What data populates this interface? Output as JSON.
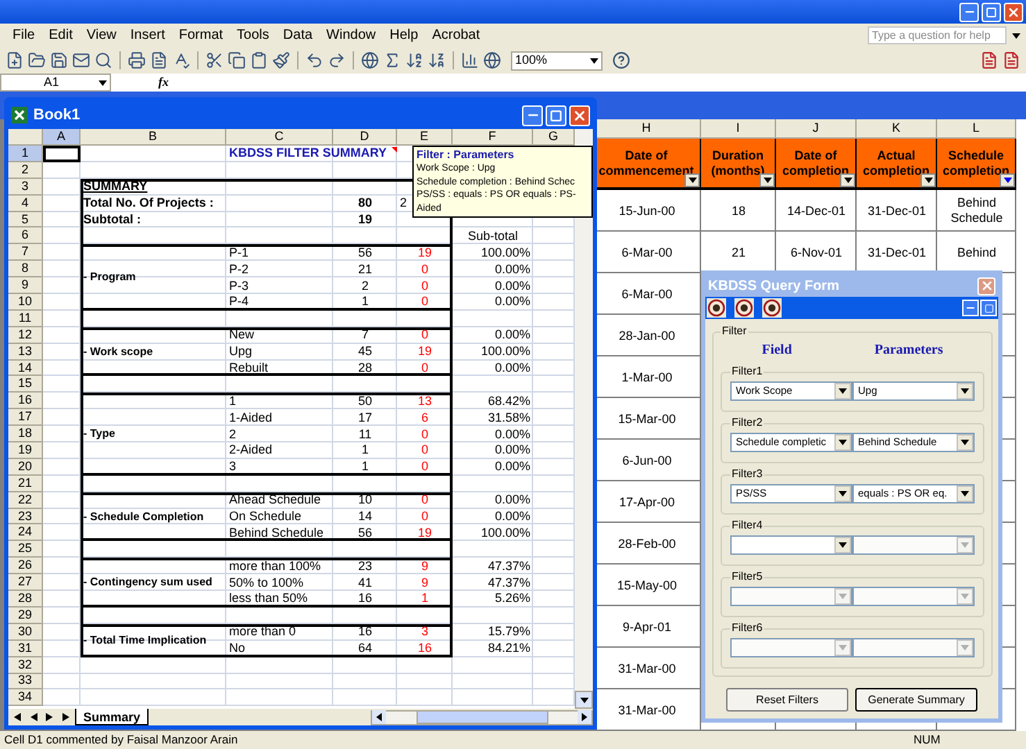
{
  "menu": [
    "File",
    "Edit",
    "View",
    "Insert",
    "Format",
    "Tools",
    "Data",
    "Window",
    "Help",
    "Acrobat"
  ],
  "help_field": {
    "placeholder": "Type a question for help"
  },
  "toolbar": {
    "zoom": "100%"
  },
  "formula_bar": {
    "name_box": "A1",
    "fx": "fx"
  },
  "back_sheet": {
    "columns": [
      "H",
      "I",
      "J",
      "K",
      "L"
    ],
    "headers": [
      {
        "label": "Date of commencement",
        "filtered": false
      },
      {
        "label": "Duration (months)",
        "filtered": false
      },
      {
        "label": "Date of completion",
        "filtered": false
      },
      {
        "label": "Actual completion",
        "filtered": false
      },
      {
        "label": "Schedule completion",
        "filtered": true
      }
    ],
    "rows": [
      [
        "15-Jun-00",
        "18",
        "14-Dec-01",
        "31-Dec-01",
        "Behind Schedule"
      ],
      [
        "6-Mar-00",
        "21",
        "6-Nov-01",
        "31-Dec-01",
        "Behind"
      ],
      [
        "6-Mar-00"
      ],
      [
        "28-Jan-00"
      ],
      [
        "1-Mar-00"
      ],
      [
        "15-Mar-00"
      ],
      [
        "6-Jun-00"
      ],
      [
        "17-Apr-00"
      ],
      [
        "28-Feb-00"
      ],
      [
        "15-May-00"
      ],
      [
        "9-Apr-01"
      ],
      [
        "31-Mar-00"
      ],
      [
        "31-Mar-00"
      ]
    ]
  },
  "book": {
    "title": "Book1",
    "columns": [
      {
        "label": "A",
        "selected": true
      },
      {
        "label": "B",
        "selected": false
      },
      {
        "label": "C",
        "selected": false
      },
      {
        "label": "D",
        "selected": false
      },
      {
        "label": "E",
        "selected": false
      },
      {
        "label": "F",
        "selected": false
      },
      {
        "label": "G",
        "selected": false
      }
    ],
    "rows": [
      {
        "label": "1",
        "selected": true
      },
      {
        "label": "2",
        "selected": false
      },
      {
        "label": "3",
        "selected": false
      },
      {
        "label": "4",
        "selected": false
      },
      {
        "label": "5",
        "selected": false
      },
      {
        "label": "6",
        "selected": false
      },
      {
        "label": "7",
        "selected": false
      },
      {
        "label": "8",
        "selected": false
      },
      {
        "label": "9",
        "selected": false
      },
      {
        "label": "10",
        "selected": false
      },
      {
        "label": "11",
        "selected": false
      },
      {
        "label": "12",
        "selected": false
      },
      {
        "label": "13",
        "selected": false
      },
      {
        "label": "14",
        "selected": false
      },
      {
        "label": "15",
        "selected": false
      },
      {
        "label": "16",
        "selected": false
      },
      {
        "label": "17",
        "selected": false
      },
      {
        "label": "18",
        "selected": false
      },
      {
        "label": "19",
        "selected": false
      },
      {
        "label": "20",
        "selected": false
      },
      {
        "label": "21",
        "selected": false
      },
      {
        "label": "22",
        "selected": false
      },
      {
        "label": "23",
        "selected": false
      },
      {
        "label": "24",
        "selected": false
      },
      {
        "label": "25",
        "selected": false
      },
      {
        "label": "26",
        "selected": false
      },
      {
        "label": "27",
        "selected": false
      },
      {
        "label": "28",
        "selected": false
      },
      {
        "label": "29",
        "selected": false
      },
      {
        "label": "30",
        "selected": false
      },
      {
        "label": "31",
        "selected": false
      },
      {
        "label": "32",
        "selected": false
      },
      {
        "label": "33",
        "selected": false
      },
      {
        "label": "34",
        "selected": false
      }
    ],
    "report": {
      "title": "KBDSS FILTER SUMMARY",
      "heading": "SUMMARY",
      "total_label": "Total No. Of Projects :",
      "total_value": "80",
      "total_extra": "2",
      "subtotal_label": "Subtotal :",
      "subtotal_value": "19",
      "share_heading": "Sub-total",
      "groups": [
        {
          "label": "- Program",
          "items": [
            [
              "P-1",
              "56",
              "19",
              "100.00%"
            ],
            [
              "P-2",
              "21",
              "0",
              "0.00%"
            ],
            [
              "P-3",
              "2",
              "0",
              "0.00%"
            ],
            [
              "P-4",
              "1",
              "0",
              "0.00%"
            ]
          ]
        },
        {
          "label": "- Work scope",
          "items": [
            [
              "New",
              "7",
              "0",
              "0.00%"
            ],
            [
              "Upg",
              "45",
              "19",
              "100.00%"
            ],
            [
              "Rebuilt",
              "28",
              "0",
              "0.00%"
            ]
          ]
        },
        {
          "label": "- Type",
          "items": [
            [
              "1",
              "50",
              "13",
              "68.42%"
            ],
            [
              "1-Aided",
              "17",
              "6",
              "31.58%"
            ],
            [
              "2",
              "11",
              "0",
              "0.00%"
            ],
            [
              "2-Aided",
              "1",
              "0",
              "0.00%"
            ],
            [
              "3",
              "1",
              "0",
              "0.00%"
            ]
          ]
        },
        {
          "label": "- Schedule Completion",
          "items": [
            [
              "Ahead Schedule",
              "10",
              "0",
              "0.00%"
            ],
            [
              "On Schedule",
              "14",
              "0",
              "0.00%"
            ],
            [
              "Behind Schedule",
              "56",
              "19",
              "100.00%"
            ]
          ]
        },
        {
          "label": "- Contingency sum used",
          "items": [
            [
              "more than 100%",
              "23",
              "9",
              "47.37%"
            ],
            [
              "50% to 100%",
              "41",
              "9",
              "47.37%"
            ],
            [
              "less than 50%",
              "16",
              "1",
              "5.26%"
            ]
          ]
        },
        {
          "label": "- Total Time Implication",
          "items": [
            [
              "more than 0",
              "16",
              "3",
              "15.79%"
            ],
            [
              "No",
              "64",
              "16",
              "84.21%"
            ]
          ]
        }
      ]
    },
    "comment": {
      "title": "Filter : Parameters",
      "lines": [
        "Work Scope : Upg",
        "Schedule completion : Behind Schec",
        "PS/SS : equals : PS OR equals : PS-",
        "Aided"
      ]
    },
    "sheet_tabs": [
      {
        "label": "Summary",
        "selected": true
      }
    ]
  },
  "query_form": {
    "title": "KBDSS Query Form",
    "group_label": "Filter",
    "field_heading": "Field",
    "parameter_heading": "Parameters",
    "filters": [
      {
        "label": "Filter1",
        "field": {
          "value": "Work Scope",
          "disabled": false
        },
        "parameter": {
          "value": "Upg",
          "disabled": false
        }
      },
      {
        "label": "Filter2",
        "field": {
          "value": "Schedule completic",
          "disabled": false
        },
        "parameter": {
          "value": "Behind Schedule",
          "disabled": false
        }
      },
      {
        "label": "Filter3",
        "field": {
          "value": "PS/SS",
          "disabled": false
        },
        "parameter": {
          "value": "equals : PS OR eq.",
          "disabled": false
        }
      },
      {
        "label": "Filter4",
        "field": {
          "disabled": false
        },
        "parameter": {
          "disabled": true
        }
      },
      {
        "label": "Filter5",
        "field": {
          "disabled": true
        },
        "parameter": {
          "disabled": true
        }
      },
      {
        "label": "Filter6",
        "field": {
          "disabled": true
        },
        "parameter": {
          "disabled": true
        }
      }
    ],
    "buttons": [
      "Reset Filters",
      "Generate Summary"
    ]
  },
  "status_bar": {
    "message": "Cell D1 commented by Faisal Manzoor Arain",
    "indicator": "NUM"
  }
}
